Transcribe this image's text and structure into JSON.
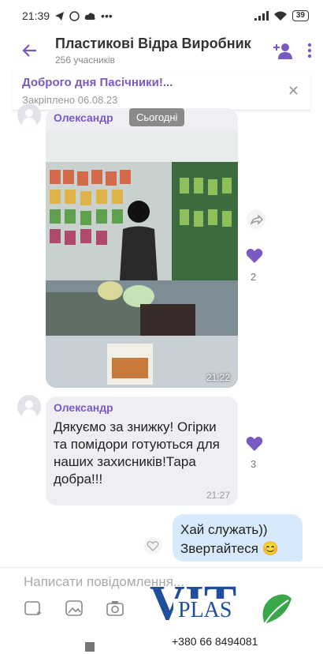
{
  "status_bar": {
    "time": "21:39",
    "icons_left": [
      "telegram-icon",
      "viber-icon",
      "cloud-icon",
      "more-dots"
    ],
    "battery": "39"
  },
  "header": {
    "title": "Пластикові Відра Виробник",
    "subtitle": "256 учасників"
  },
  "pinned": {
    "title": "Доброго дня Пасічники!...",
    "date": "Закріплено 06.08.23"
  },
  "date_chip": "Сьогодні",
  "messages": [
    {
      "sender": "Олександр",
      "type": "photo",
      "time": "21:22",
      "forward_icon": "share-icon",
      "likes": "2"
    },
    {
      "sender": "Олександр",
      "text": "Дякуємо за знижку! Огірки та помідори готуються для наших захисників!Тара добра!!!",
      "time": "21:27",
      "likes": "3"
    },
    {
      "type": "outgoing",
      "text": "Хай служать)) Звертайтеся 😊"
    }
  ],
  "composer": {
    "placeholder": "Написати повідомлення..."
  },
  "logo": {
    "brand_top": "VIT",
    "brand_sub": "PLAS",
    "phone": "+380 66 8494081"
  },
  "colors": {
    "accent": "#7b59c3",
    "bubble_in": "#efeff3",
    "bubble_out": "#d7eafc",
    "logo_blue": "#1f4e9e",
    "logo_green": "#3aa84a"
  }
}
